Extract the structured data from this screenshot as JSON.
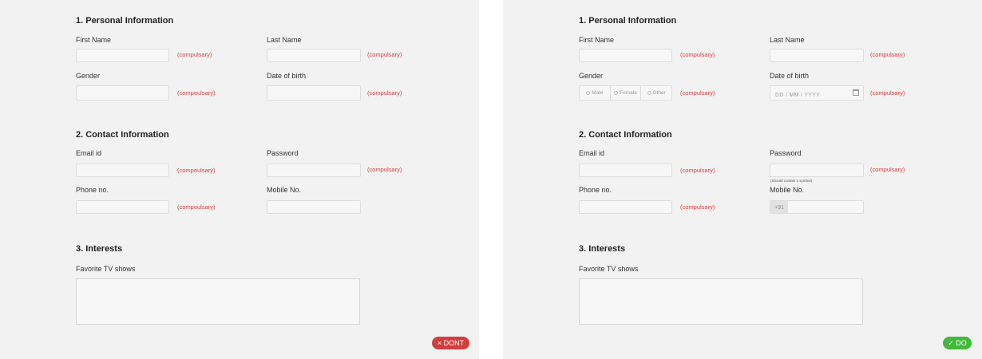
{
  "sections": {
    "personal": "1. Personal Information",
    "contact": "2. Contact Information",
    "interests": "3. Interests"
  },
  "fields": {
    "first_name": "First Name",
    "last_name": "Last Name",
    "gender": "Gender",
    "dob": "Date of birth",
    "email": "Email id",
    "password": "Password",
    "phone": "Phone no.",
    "mobile": "Mobile No.",
    "tv_shows": "Favorite TV shows"
  },
  "required_label": "(compulsary)",
  "required_label_alt": "(compoulsary)",
  "gender_options": [
    "Male",
    "Female",
    "Other"
  ],
  "dob_placeholder": "DD / MM / YYYY",
  "password_hint": "(Should contain 1 symbol)",
  "mobile_prefix": "+91",
  "badges": {
    "dont": "× DONT",
    "do": "✓ DO"
  }
}
